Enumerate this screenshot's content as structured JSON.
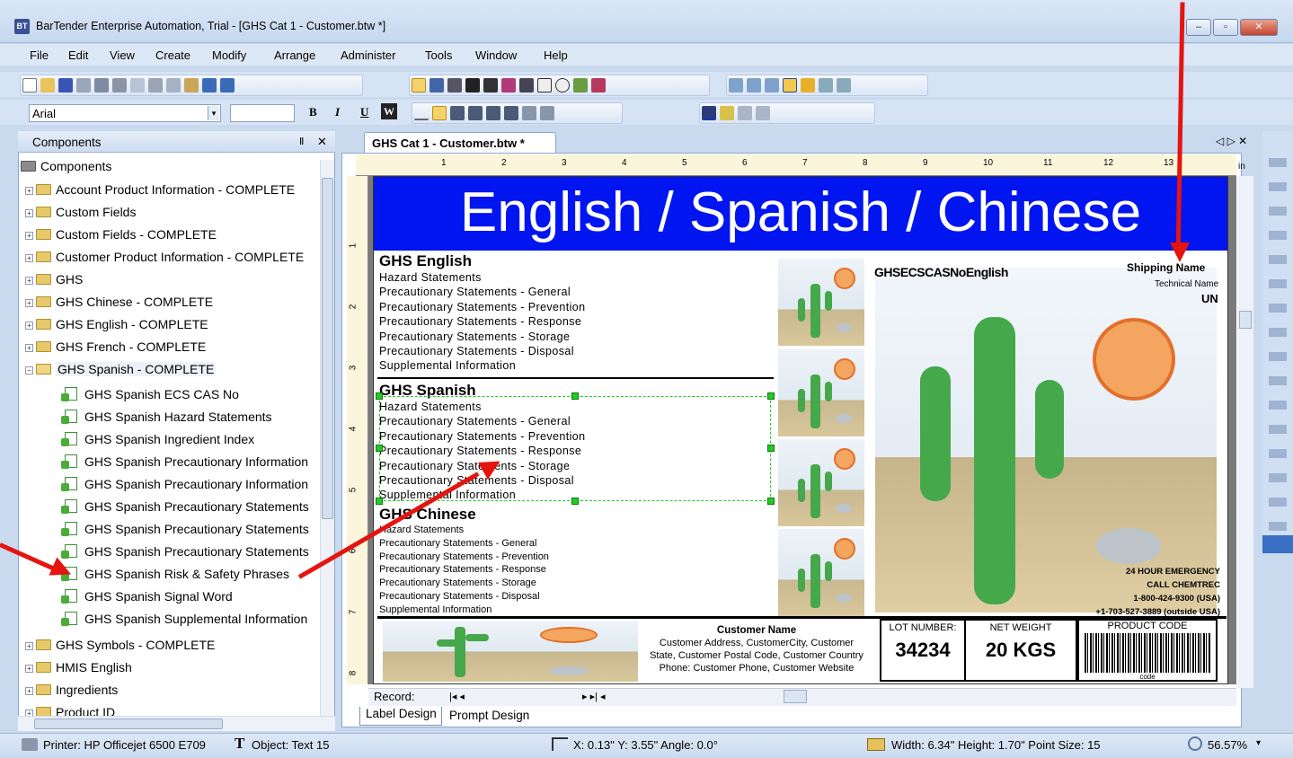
{
  "window": {
    "title": "BarTender Enterprise Automation, Trial - [GHS Cat 1 - Customer.btw *]",
    "minimize": "–",
    "restore": "▫",
    "close": "✕"
  },
  "menubar": [
    "File",
    "Edit",
    "View",
    "Create",
    "Modify",
    "Arrange",
    "Administer",
    "Tools",
    "Window",
    "Help"
  ],
  "format_bar": {
    "font": "Arial",
    "size": "",
    "bold": "B",
    "italic": "I",
    "underline": "U",
    "wordart": "W"
  },
  "components_panel": {
    "title": "Components",
    "pin": "Ⅱ",
    "close": "✕",
    "root": "Components",
    "folders_top": [
      "Account Product Information - COMPLETE",
      "Custom Fields",
      "Custom Fields - COMPLETE",
      "Customer Product Information - COMPLETE",
      "GHS",
      "GHS Chinese - COMPLETE",
      "GHS English - COMPLETE",
      "GHS French - COMPLETE"
    ],
    "open_folder": "GHS Spanish - COMPLETE",
    "fields": [
      "GHS Spanish ECS CAS No",
      "GHS Spanish Hazard Statements",
      "GHS Spanish Ingredient Index",
      "GHS Spanish Precautionary Information",
      "GHS Spanish Precautionary Information",
      "GHS Spanish Precautionary Statements",
      "GHS Spanish Precautionary Statements",
      "GHS Spanish Precautionary Statements",
      "GHS Spanish Risk & Safety Phrases",
      "GHS Spanish Signal Word",
      "GHS Spanish Supplemental Information"
    ],
    "folders_bottom": [
      "GHS Symbols - COMPLETE",
      "HMIS English",
      "Ingredients",
      "Product ID"
    ]
  },
  "document": {
    "tab": "GHS Cat 1 - Customer.btw *",
    "nav": "◁ ▷ ✕",
    "ruler_units": "in",
    "ruler_numbers": [
      "1",
      "2",
      "3",
      "4",
      "5",
      "6",
      "7",
      "8",
      "9",
      "10",
      "11",
      "12",
      "13"
    ],
    "ruler_left_numbers": [
      "1",
      "2",
      "3",
      "4",
      "5",
      "6",
      "7",
      "8"
    ],
    "banner": "English / Spanish / Chinese",
    "sections": [
      {
        "heading": "GHS English",
        "lines": [
          "Hazard Statements",
          "Precautionary Statements - General",
          "Precautionary Statements - Prevention",
          "Precautionary Statements - Response",
          "Precautionary Statements - Storage",
          "Precautionary Statements - Disposal",
          "Supplemental Information"
        ]
      },
      {
        "heading": "GHS Spanish",
        "lines": [
          "Hazard Statements",
          "Precautionary Statements - General",
          "Precautionary Statements - Prevention",
          "Precautionary Statements - Response",
          "Precautionary Statements - Storage",
          "Precautionary Statements - Disposal",
          "Supplemental Information"
        ]
      },
      {
        "heading": "GHS Chinese",
        "lines": [
          "Hazard Statements",
          "Precautionary Statements - General",
          "Precautionary Statements - Prevention",
          "Precautionary Statements - Response",
          "Precautionary Statements - Storage",
          "Precautionary Statements - Disposal",
          "Supplemental Information"
        ]
      }
    ],
    "cas_label": "GHSECSCASNoEnglish",
    "shipping_name": "Shipping Name",
    "technical_name": "Technical Name",
    "un": "UN",
    "emergency": [
      "24 HOUR EMERGENCY",
      "CALL CHEMTREC",
      "1-800-424-9300 (USA)",
      "+1-703-527-3889 (outside USA)"
    ],
    "customer": {
      "name": "Customer Name",
      "line1": "Customer Address, CustomerCity, Customer",
      "line2": "State, Customer Postal Code, Customer Country",
      "line3": "Phone: Customer Phone, Customer Website"
    },
    "lot": {
      "label": "LOT NUMBER:",
      "value": "34234"
    },
    "weight": {
      "label": "NET WEIGHT",
      "value": "20 KGS"
    },
    "product_code": {
      "label": "PRODUCT CODE",
      "caption": "code"
    },
    "record_label": "Record:",
    "record_nav": "|◂ ◂",
    "record_nav_right": "▸ ▸| ◂",
    "tabs": [
      "Label Design",
      "Prompt Design"
    ]
  },
  "status": {
    "printer": "Printer: HP Officejet 6500 E709",
    "object": "Object: Text 15",
    "coords": "X: 0.13\"  Y: 3.55\"  Angle: 0.0°",
    "size": "Width: 6.34\"  Height: 1.70\"  Point Size: 15",
    "zoom": "56.57%"
  },
  "colors": {
    "banner": "#0015f0",
    "annotation_arrow": "#e4140f",
    "selection": "#22cc22"
  }
}
